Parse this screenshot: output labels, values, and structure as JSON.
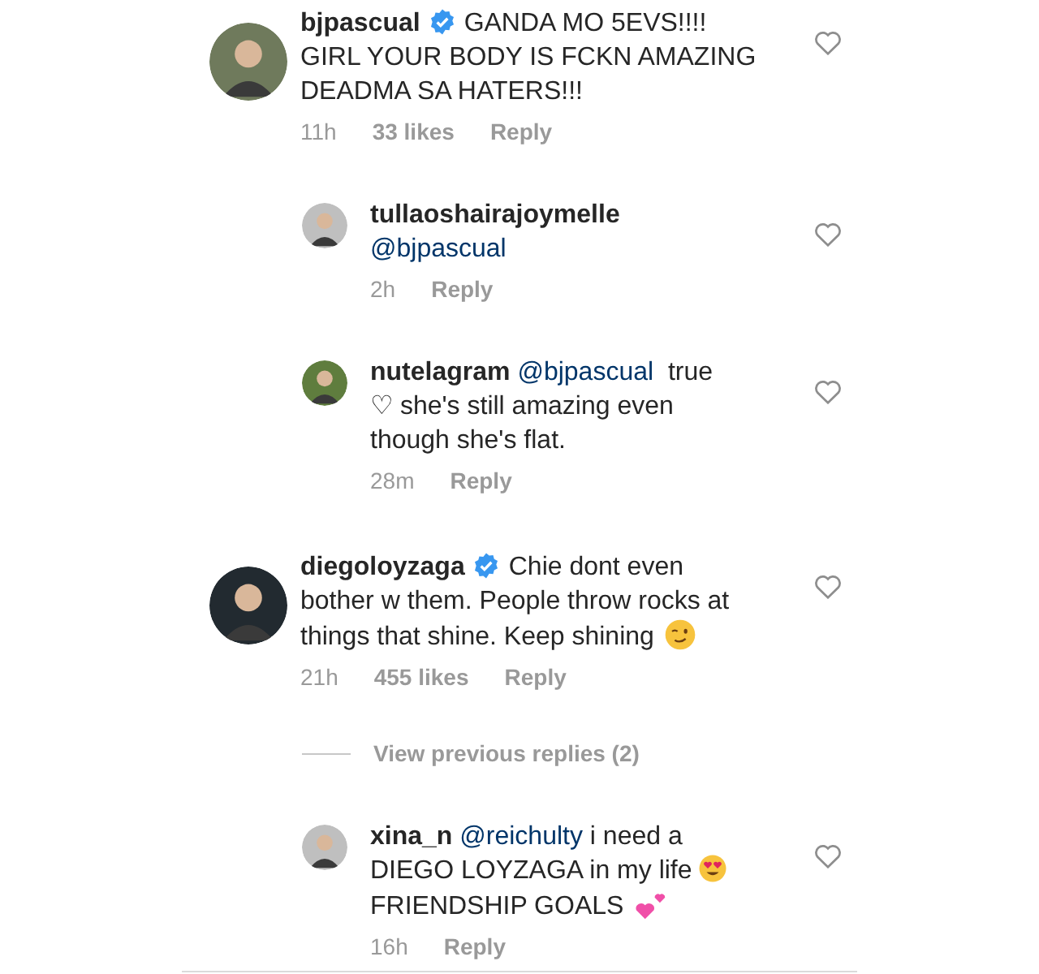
{
  "comments": [
    {
      "username": "bjpascual",
      "verified": true,
      "segments": [
        {
          "kind": "text",
          "text": "GANDA MO 5EVS!!!! GIRL YOUR BODY IS FCKN AMAZING DEADMA SA HATERS!!!"
        }
      ],
      "time": "11h",
      "likes": "33 likes",
      "reply": "Reply",
      "liked": false,
      "replies": [
        {
          "username": "tullaoshairajoymelle",
          "verified": false,
          "segments": [
            {
              "kind": "break"
            },
            {
              "kind": "mention",
              "text": "@bjpascual"
            }
          ],
          "time": "2h",
          "reply": "Reply",
          "liked": false
        },
        {
          "username": "nutelagram",
          "verified": false,
          "segments": [
            {
              "kind": "mention",
              "text": "@bjpascual"
            },
            {
              "kind": "text",
              "text": "  true ♡ she's still amazing even though she's flat."
            }
          ],
          "time": "28m",
          "reply": "Reply",
          "liked": false
        }
      ]
    },
    {
      "username": "diegoloyzaga",
      "verified": true,
      "segments": [
        {
          "kind": "text",
          "text": "Chie dont even bother w them. People throw rocks at things that shine. Keep shining"
        },
        {
          "kind": "wink"
        }
      ],
      "time": "21h",
      "likes": "455 likes",
      "reply": "Reply",
      "liked": false,
      "view_previous": "View previous replies (2)",
      "replies": [
        {
          "username": "xina_n",
          "verified": false,
          "segments": [
            {
              "kind": "mention",
              "text": "@reichulty"
            },
            {
              "kind": "text",
              "text": " i need a DIEGO LOYZAGA in my life"
            },
            {
              "kind": "heart-eyes"
            },
            {
              "kind": "text",
              "text": " FRIENDSHIP GOALS"
            },
            {
              "kind": "hearts"
            }
          ],
          "time": "16h",
          "reply": "Reply",
          "liked": false
        }
      ]
    }
  ]
}
